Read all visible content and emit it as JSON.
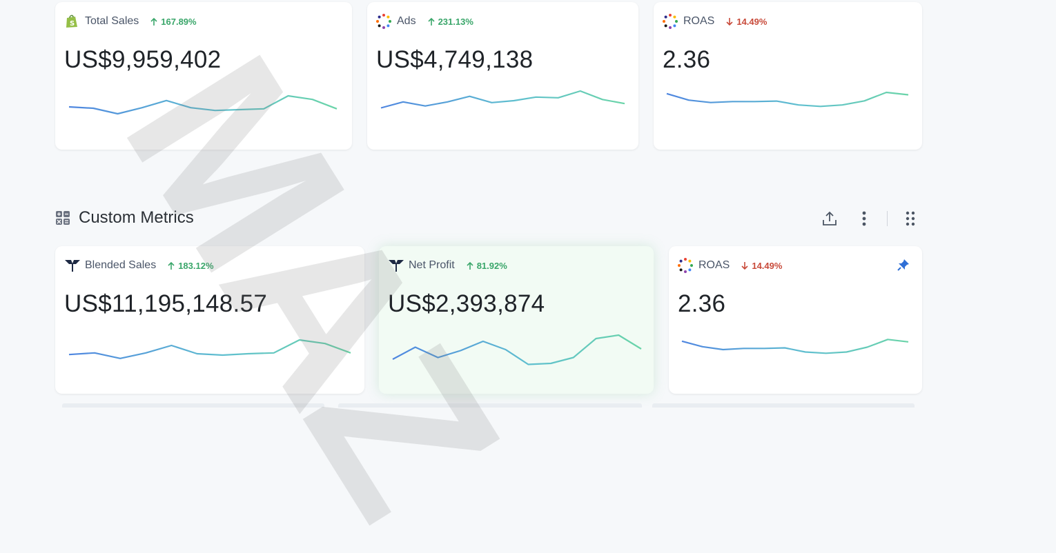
{
  "top_cards": [
    {
      "title": "Total Sales",
      "change": "167.89%",
      "direction": "up",
      "value": "US$9,959,402",
      "icon": "shopify-icon",
      "spark": [
        0.55,
        0.5,
        0.3,
        0.52,
        0.78,
        0.52,
        0.42,
        0.45,
        0.48,
        0.95,
        0.82,
        0.48
      ]
    },
    {
      "title": "Ads",
      "change": "231.13%",
      "direction": "up",
      "value": "US$4,749,138",
      "icon": "multicolor-dots-icon",
      "spark": [
        0.3,
        0.55,
        0.38,
        0.55,
        0.78,
        0.52,
        0.6,
        0.75,
        0.72,
        1.0,
        0.65,
        0.48
      ]
    },
    {
      "title": "ROAS",
      "change": "14.49%",
      "direction": "down",
      "value": "2.36",
      "icon": "multicolor-dots-icon",
      "spark": [
        0.75,
        0.48,
        0.38,
        0.42,
        0.42,
        0.44,
        0.28,
        0.22,
        0.28,
        0.45,
        0.8,
        0.7
      ]
    }
  ],
  "section": {
    "title": "Custom Metrics"
  },
  "metric_cards": [
    {
      "title": "Blended Sales",
      "change": "183.12%",
      "direction": "up",
      "value": "US$11,195,148.57",
      "icon": "triple-whale-icon",
      "pinned": false,
      "spark": [
        0.42,
        0.48,
        0.28,
        0.48,
        0.75,
        0.45,
        0.4,
        0.45,
        0.48,
        0.95,
        0.82,
        0.48
      ]
    },
    {
      "title": "Net Profit",
      "change": "81.92%",
      "direction": "up",
      "value": "US$2,393,874",
      "icon": "triple-whale-icon",
      "pinned": false,
      "spark": [
        0.2,
        0.55,
        0.25,
        0.45,
        0.72,
        0.48,
        0.05,
        0.08,
        0.25,
        0.8,
        0.9,
        0.5
      ]
    },
    {
      "title": "ROAS",
      "change": "14.49%",
      "direction": "down",
      "value": "2.36",
      "icon": "multicolor-dots-icon",
      "pinned": true,
      "spark": [
        0.75,
        0.52,
        0.4,
        0.45,
        0.45,
        0.47,
        0.3,
        0.25,
        0.3,
        0.5,
        0.82,
        0.72
      ]
    }
  ],
  "watermark": "MAZ"
}
